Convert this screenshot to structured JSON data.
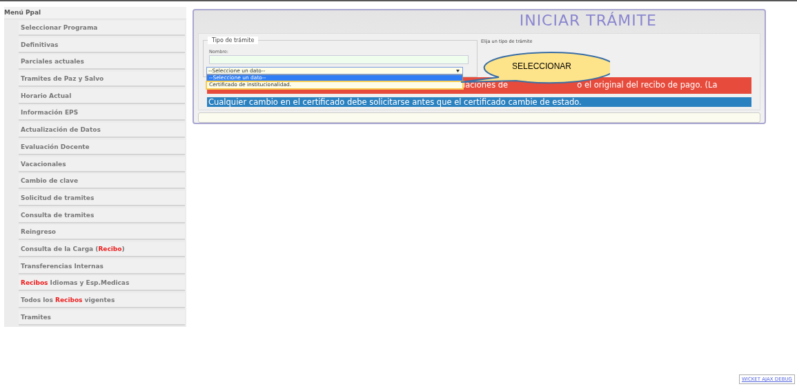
{
  "sidebar": {
    "title": "Menú Ppal",
    "items": [
      {
        "parts": [
          {
            "text": "Seleccionar Programa",
            "highlight": false
          }
        ]
      },
      {
        "parts": [
          {
            "text": "Definitivas",
            "highlight": false
          }
        ]
      },
      {
        "parts": [
          {
            "text": "Parciales actuales",
            "highlight": false
          }
        ]
      },
      {
        "parts": [
          {
            "text": "Tramites de Paz y Salvo",
            "highlight": false
          }
        ]
      },
      {
        "parts": [
          {
            "text": "Horario Actual",
            "highlight": false
          }
        ]
      },
      {
        "parts": [
          {
            "text": "Información EPS",
            "highlight": false
          }
        ]
      },
      {
        "parts": [
          {
            "text": "Actualización de Datos",
            "highlight": false
          }
        ]
      },
      {
        "parts": [
          {
            "text": "Evaluación Docente",
            "highlight": false
          }
        ]
      },
      {
        "parts": [
          {
            "text": "Vacacionales",
            "highlight": false
          }
        ]
      },
      {
        "parts": [
          {
            "text": "Cambio de clave",
            "highlight": false
          }
        ]
      },
      {
        "parts": [
          {
            "text": "Solicitud de tramites",
            "highlight": false
          }
        ]
      },
      {
        "parts": [
          {
            "text": "Consulta de tramites",
            "highlight": false
          }
        ]
      },
      {
        "parts": [
          {
            "text": "Reingreso",
            "highlight": false
          }
        ]
      },
      {
        "parts": [
          {
            "text": "Consulta de la Carga (",
            "highlight": false
          },
          {
            "text": "Recibo",
            "highlight": true
          },
          {
            "text": ")",
            "highlight": false
          }
        ]
      },
      {
        "parts": [
          {
            "text": "Transferencias Internas",
            "highlight": false
          }
        ]
      },
      {
        "parts": [
          {
            "text": "Recibos",
            "highlight": true
          },
          {
            "text": " Idiomas y Esp.Medicas",
            "highlight": false
          }
        ]
      },
      {
        "parts": [
          {
            "text": "Todos los ",
            "highlight": false
          },
          {
            "text": "Recibos",
            "highlight": true
          },
          {
            "text": " vigentes",
            "highlight": false
          }
        ]
      },
      {
        "parts": [
          {
            "text": "Tramites",
            "highlight": false
          }
        ]
      }
    ]
  },
  "main": {
    "title": "INICIAR TRÁMITE",
    "fieldset": {
      "legend": "Tipo de trámite",
      "name_label": "Nombre:",
      "select": {
        "value": "--Seleccione un dato--",
        "expanded": true,
        "options": [
          {
            "label": "--Seleccione un dato--",
            "selected": true,
            "highlighted": false
          },
          {
            "label": "Certificado de institucionalidad.",
            "selected": false,
            "highlighted": true
          }
        ]
      }
    },
    "hint": "Elija un tipo de trámite",
    "warning_fragments": [
      "laciones de",
      "o el original del recibo de pago. (La"
    ],
    "info": "Cualquier cambio en el certificado debe solicitarse antes que el certificado cambie de estado."
  },
  "callout": {
    "text": "SELECCIONAR"
  },
  "debug_link": "WICKET AJAX DEBUG"
}
